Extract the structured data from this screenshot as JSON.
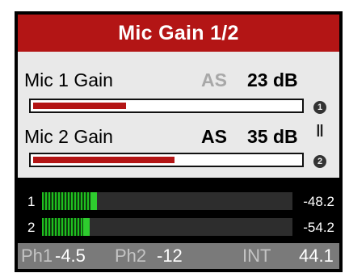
{
  "title": "Mic Gain 1/2",
  "colors": {
    "accent": "#b31515",
    "meter_green": "#2ecc2e",
    "panel": "#e9e9e9"
  },
  "rows": [
    {
      "label": "Mic 1 Gain",
      "as": "AS",
      "as_active": false,
      "value": "23 dB",
      "level": 0.35,
      "icon": "encoder-1-icon",
      "icon_text": "1"
    },
    {
      "label": "Mic 2 Gain",
      "as": "AS",
      "as_active": true,
      "value": "35 dB",
      "level": 0.53,
      "icon": "encoder-2-icon",
      "icon_text": "2"
    }
  ],
  "link_symbol": "‖",
  "meters": [
    {
      "label": "1",
      "value": "-48.2",
      "level": 0.22
    },
    {
      "label": "2",
      "value": "-54.2",
      "level": 0.19
    }
  ],
  "status": {
    "ph1_label": "Ph1",
    "ph1_value": "-4.5",
    "ph2_label": "Ph2",
    "ph2_value": "-12",
    "int_label": "INT",
    "rate": "44.1"
  }
}
